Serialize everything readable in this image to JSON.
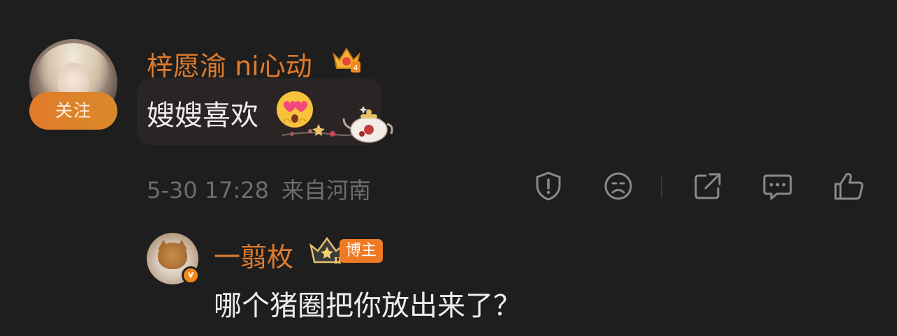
{
  "main_comment": {
    "username": "梓愿渝 ni心动",
    "level_badge": "4",
    "follow_label": "关注",
    "text": "嫂嫂喜欢",
    "emoji": "heart-eyes-emoji",
    "decoration": "teapot-sticker",
    "timestamp": "5-30 17:28",
    "location": "来自河南",
    "actions": [
      "report-icon",
      "dislike-icon",
      "share-icon",
      "comment-icon",
      "like-icon"
    ]
  },
  "reply": {
    "username": "一翦枚",
    "crown_level": "II",
    "tag": "博主",
    "verified_badge": "v",
    "text": "哪个猪圈把你放出来了？"
  },
  "colors": {
    "background": "#1e1e1e",
    "username": "#e07b2c",
    "text": "#ededed",
    "meta": "#6d6d6d",
    "accent": "#f07a24"
  }
}
